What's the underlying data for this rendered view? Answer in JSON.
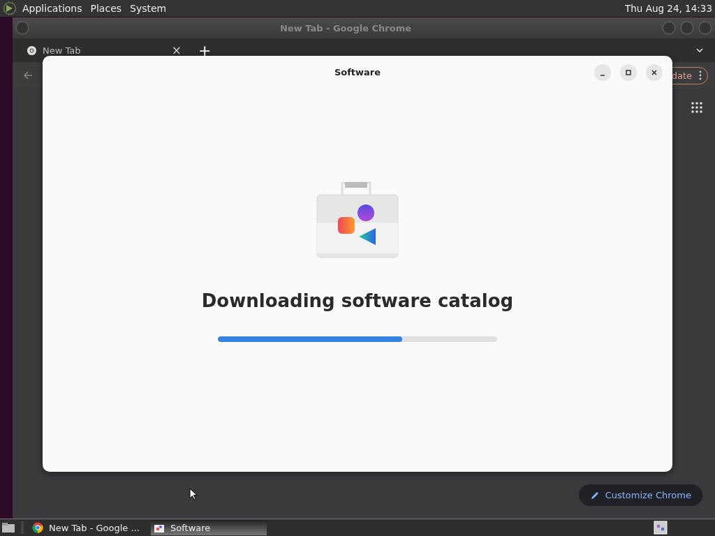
{
  "top_panel": {
    "menus": [
      "Applications",
      "Places",
      "System"
    ],
    "clock": "Thu Aug 24, 14:33"
  },
  "browser": {
    "title": "New Tab - Google Chrome",
    "tab": {
      "label": "New Tab",
      "close": "×"
    },
    "new_tab": "+",
    "update_button": "date",
    "customize_button": "Customize Chrome"
  },
  "dialog": {
    "title": "Software",
    "heading": "Downloading software catalog",
    "progress": {
      "level": 0.66
    }
  },
  "taskbar": {
    "items": [
      {
        "label": "New Tab - Google ...",
        "kind": "browser",
        "selected": false
      },
      {
        "label": "Software",
        "kind": "store",
        "selected": true
      }
    ]
  }
}
